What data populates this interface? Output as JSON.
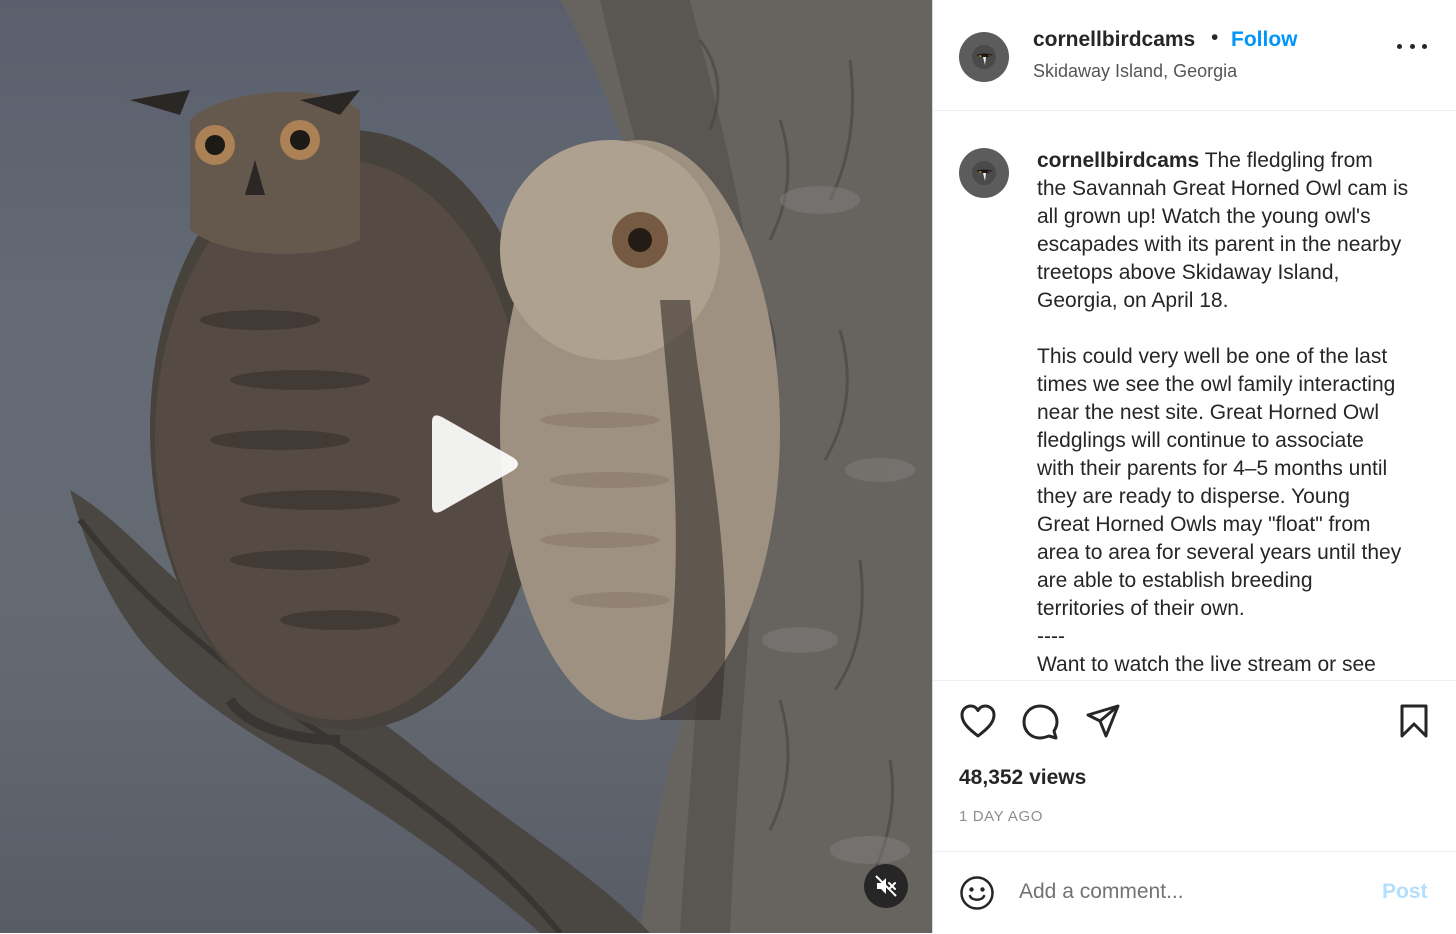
{
  "post": {
    "username": "cornellbirdcams",
    "follow_label": "Follow",
    "separator": "•",
    "location": "Skidaway Island, Georgia",
    "caption": {
      "username": "cornellbirdcams",
      "lines": [
        "The fledgling from",
        "the Savannah Great Horned Owl cam is",
        "all grown up! Watch the young owl's",
        "escapades with its parent in the nearby",
        "treetops above Skidaway Island,",
        "Georgia, on April 18.",
        "",
        "This could very well be one of the last",
        "times we see the owl family interacting",
        "near the nest site. Great Horned Owl",
        "fledglings will continue to associate",
        "with their parents for 4–5 months until",
        "they are ready to disperse. Young",
        "Great Horned Owls may \"float\" from",
        "area to area for several years until they",
        "are able to establish breeding",
        "territories of their own.",
        "----",
        "Want to watch the live stream or see"
      ]
    },
    "views": "48,352 views",
    "time_ago": "1 DAY AGO",
    "comment_placeholder": "Add a comment...",
    "post_label": "Post"
  },
  "icons": {
    "more": "more-options-icon",
    "like": "heart-icon",
    "comment": "comment-bubble-icon",
    "share": "paper-plane-icon",
    "save": "bookmark-icon",
    "emoji": "smiley-icon",
    "play": "play-icon",
    "mute": "muted-speaker-icon"
  },
  "colors": {
    "accent": "#0095f6",
    "post_disabled": "#b2dffc",
    "text": "#262626",
    "muted": "#8e8e8e"
  }
}
